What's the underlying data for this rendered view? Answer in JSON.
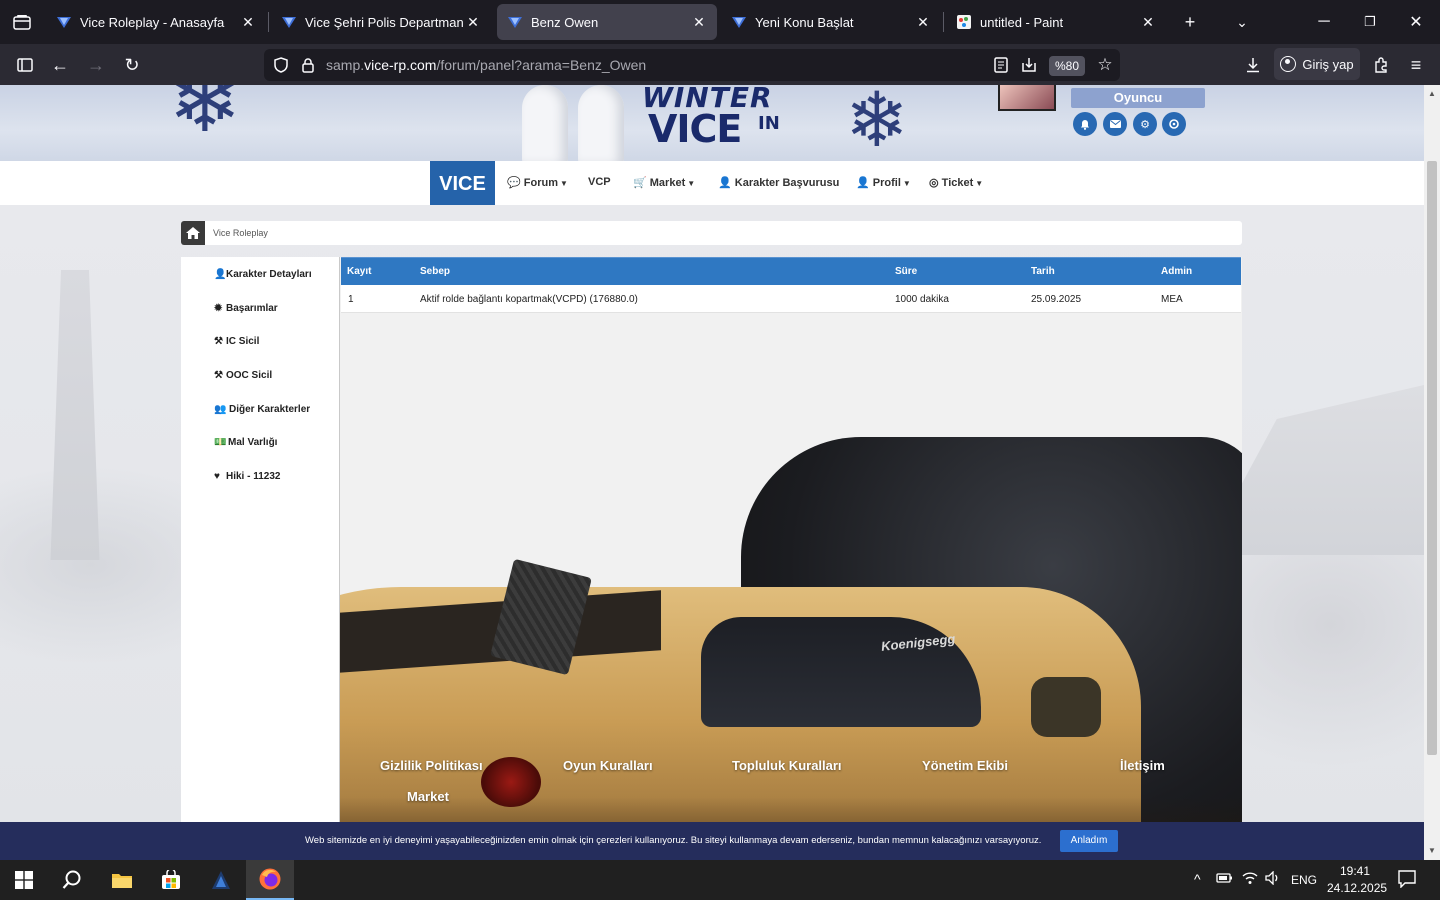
{
  "browser": {
    "tabs": [
      {
        "title": "Vice Roleplay - Anasayfa",
        "active": false
      },
      {
        "title": "Vice Şehri Polis Departmanı",
        "active": false
      },
      {
        "title": "Benz Owen",
        "active": true
      },
      {
        "title": "Yeni Konu Başlat",
        "active": false
      },
      {
        "title": "untitled - Paint",
        "active": false
      }
    ],
    "url_prefix": "samp.",
    "url_domain": "vice-rp.com",
    "url_path": "/forum/panel?arama=Benz_Owen",
    "zoom": "%80",
    "signin_label": "Giriş yap"
  },
  "site": {
    "banner": {
      "logo_line1": "WINTER",
      "logo_line2": "VICE",
      "logo_line3": "IN",
      "role_badge": "Oyuncu"
    },
    "menu": {
      "brand": "VICE",
      "items": [
        {
          "label": "Forum",
          "has_caret": true
        },
        {
          "label": "VCP",
          "has_caret": false
        },
        {
          "label": "Market",
          "has_caret": true
        },
        {
          "label": "Karakter Başvurusu",
          "has_caret": false
        },
        {
          "label": "Profil",
          "has_caret": true
        },
        {
          "label": "Ticket",
          "has_caret": true
        }
      ]
    },
    "breadcrumb": "Vice Roleplay",
    "sidebar": [
      {
        "label": "Karakter Detayları",
        "icon": "user-icon"
      },
      {
        "label": "Başarımlar",
        "icon": "gear-icon"
      },
      {
        "label": "IC Sicil",
        "icon": "gavel-icon"
      },
      {
        "label": "OOC Sicil",
        "icon": "gavel-icon"
      },
      {
        "label": "Diğer Karakterler",
        "icon": "users-icon"
      },
      {
        "label": "Mal Varlığı",
        "icon": "money-icon"
      },
      {
        "label": "Hiki - 11232",
        "icon": "heart-icon"
      }
    ],
    "table": {
      "headers": [
        "Kayıt",
        "Sebep",
        "Süre",
        "Tarih",
        "Admin"
      ],
      "rows": [
        [
          "1",
          "Aktif rolde bağlantı kopartmak(VCPD) (176880.0)",
          "1000 dakika",
          "25.09.2025",
          "MEA"
        ]
      ]
    },
    "car_badge": "Koenigsegg",
    "footer_links": [
      "Gizlilik Politikası",
      "Oyun Kuralları",
      "Topluluk Kuralları",
      "Yönetim Ekibi",
      "İletişim",
      "Market"
    ],
    "cookie": {
      "text": "Web sitemizde en iyi deneyimi yaşayabileceğinizden emin olmak için çerezleri kullanıyoruz. Bu siteyi kullanmaya devam ederseniz, bundan memnun kalacağınızı varsayıyoruz.",
      "button": "Anladım"
    }
  },
  "taskbar": {
    "lang": "ENG",
    "time": "19:41",
    "date": "24.12.2025"
  },
  "colors": {
    "brand_blue": "#2563aa",
    "table_header": "#2f78c2",
    "cookie_bar": "#252d5c",
    "tab_active": "#42414d"
  }
}
